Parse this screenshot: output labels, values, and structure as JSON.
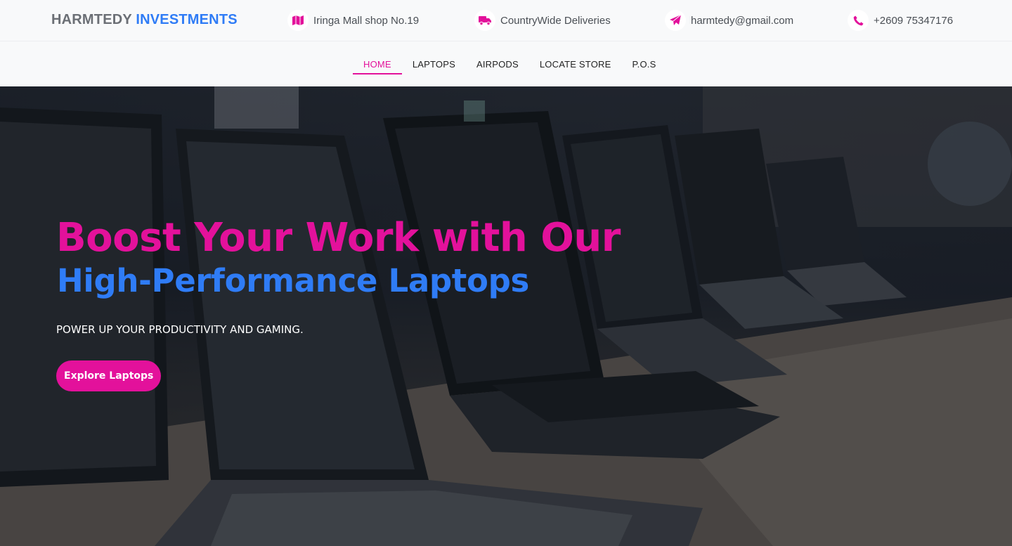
{
  "header": {
    "brand_part1": "HARMTEDY",
    "brand_part2": "INVESTMENTS",
    "location": "Iringa Mall shop No.19",
    "delivery": "CountryWide Deliveries",
    "email": "harmtedy@gmail.com",
    "phone": "+2609 75347176"
  },
  "nav": {
    "items": [
      {
        "label": "HOME",
        "active": true
      },
      {
        "label": "LAPTOPS",
        "active": false
      },
      {
        "label": "AIRPODS",
        "active": false
      },
      {
        "label": "LOCATE STORE",
        "active": false
      },
      {
        "label": "P.O.S",
        "active": false
      }
    ]
  },
  "hero": {
    "title_line1": "Boost Your Work with Our",
    "title_line2": "High-Performance Laptops",
    "subtitle": "POWER UP YOUR PRODUCTIVITY AND GAMING.",
    "cta_label": "Explore Laptops"
  },
  "colors": {
    "accent": "#e3119b",
    "brand_blue": "#2f7cf6",
    "brand_gray": "#6b6f75"
  },
  "icons": {
    "location": "map-icon",
    "delivery": "truck-icon",
    "email": "paper-plane-icon",
    "phone": "phone-icon"
  }
}
